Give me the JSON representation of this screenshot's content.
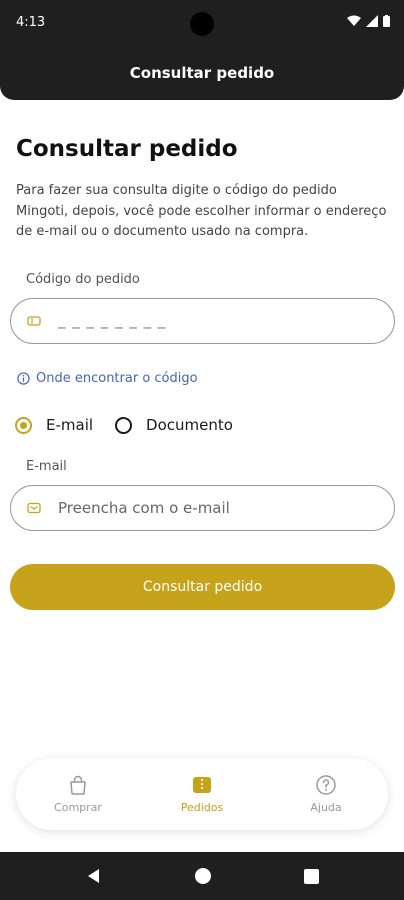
{
  "status_bar": {
    "time": "4:13"
  },
  "header": {
    "title": "Consultar pedido"
  },
  "main": {
    "title": "Consultar pedido",
    "intro": "Para fazer sua consulta digite o código do pedido Mingoti, depois, você pode escolher informar o endereço de e-mail ou o documento usado na compra.",
    "order_code": {
      "label": "Código do pedido",
      "value": "_ _ _ _ _ _ _ _"
    },
    "help_link": "Onde encontrar o código",
    "contact_type": {
      "options": [
        {
          "label": "E-mail",
          "selected": true
        },
        {
          "label": "Documento",
          "selected": false
        }
      ]
    },
    "email": {
      "label": "E-mail",
      "placeholder": "Preencha com o e-mail"
    },
    "submit_label": "Consultar pedido"
  },
  "bottom_nav": {
    "items": [
      {
        "label": "Comprar",
        "icon": "shopping-bag-icon",
        "active": false
      },
      {
        "label": "Pedidos",
        "icon": "orders-icon",
        "active": true
      },
      {
        "label": "Ajuda",
        "icon": "help-icon",
        "active": false
      }
    ]
  },
  "colors": {
    "accent": "#c7a21b",
    "link": "#4a63b8",
    "dark": "#1f1f1f"
  }
}
